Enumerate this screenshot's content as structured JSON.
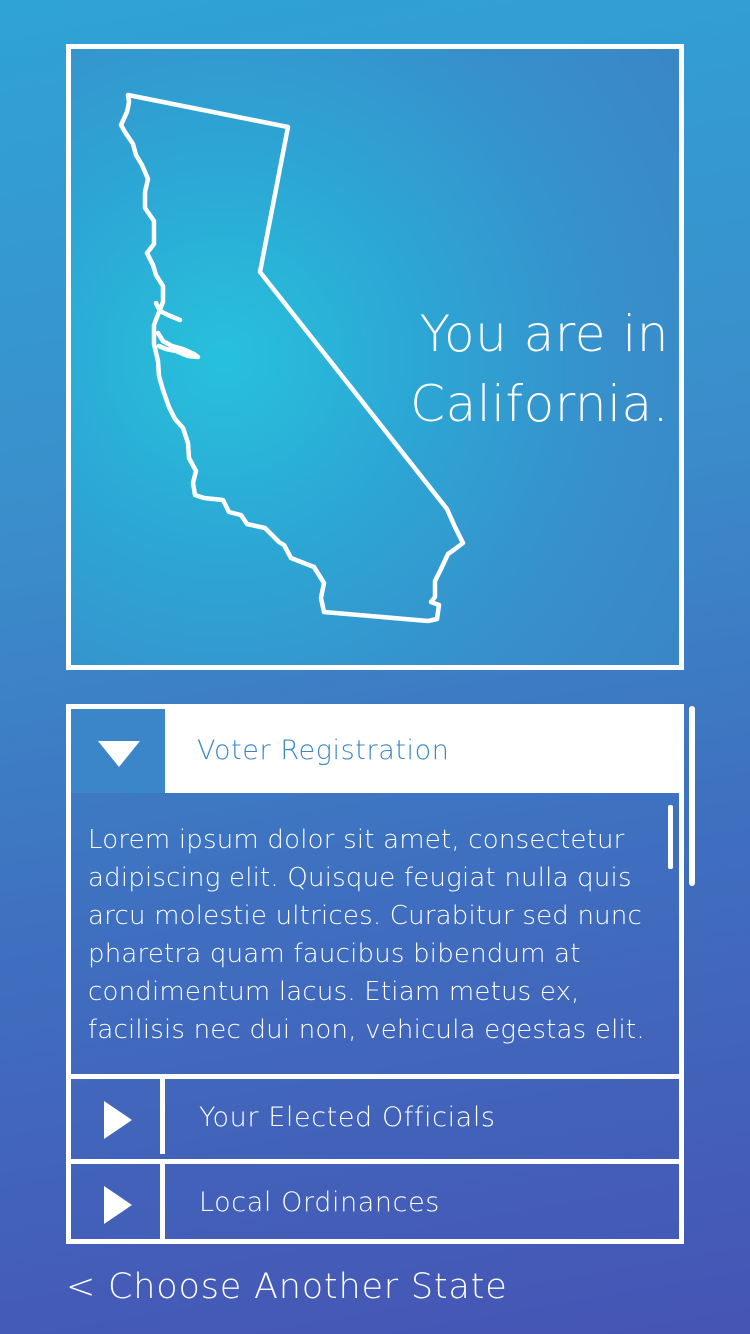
{
  "hero": {
    "line1": "You are in",
    "line2": "California.",
    "map_icon": "california-outline-icon"
  },
  "accordion": {
    "sections": [
      {
        "label": "Voter Registration",
        "expanded": true,
        "icon": "triangle-down-icon",
        "body": "Lorem ipsum dolor sit amet, consectetur adipiscing elit. Quisque feugiat nulla quis arcu molestie ultrices. Curabitur sed nunc pharetra quam faucibus bibendum at condimentum lacus. Etiam metus ex, facilisis nec dui non, vehicula egestas elit."
      },
      {
        "label": "Your Elected Officials",
        "expanded": false,
        "icon": "triangle-right-icon"
      },
      {
        "label": "Local Ordinances",
        "expanded": false,
        "icon": "triangle-right-icon"
      }
    ]
  },
  "footer": {
    "back_label": "< Choose Another State"
  },
  "colors": {
    "background_top": "#2fa3d6",
    "background_bottom": "#4654b4",
    "accent": "#3a86c8",
    "foreground": "#ffffff"
  }
}
